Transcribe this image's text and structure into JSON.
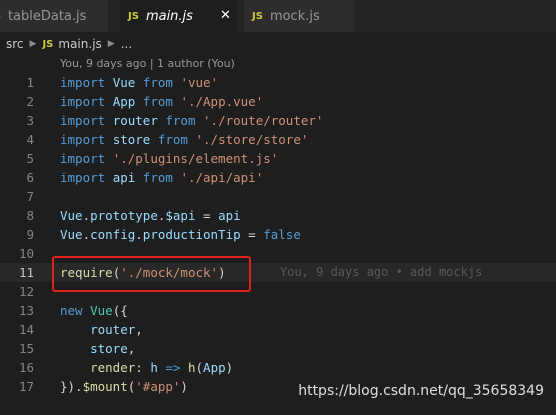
{
  "tabs": [
    {
      "icon": "JS",
      "label": "tableData.js"
    },
    {
      "icon": "JS",
      "label": "main.js",
      "close": "✕"
    },
    {
      "icon": "JS",
      "label": "mock.js"
    }
  ],
  "breadcrumb": {
    "folder": "src",
    "file_icon": "JS",
    "file": "main.js",
    "more": "..."
  },
  "codelens": "You, 9 days ago | 1 author (You)",
  "lines": [
    {
      "n": "1",
      "tokens": [
        [
          "kw",
          "import"
        ],
        [
          "pl",
          " "
        ],
        [
          "id",
          "Vue"
        ],
        [
          "pl",
          " "
        ],
        [
          "kw",
          "from"
        ],
        [
          "pl",
          " "
        ],
        [
          "str",
          "'vue'"
        ]
      ]
    },
    {
      "n": "2",
      "tokens": [
        [
          "kw",
          "import"
        ],
        [
          "pl",
          " "
        ],
        [
          "id",
          "App"
        ],
        [
          "pl",
          " "
        ],
        [
          "kw",
          "from"
        ],
        [
          "pl",
          " "
        ],
        [
          "str",
          "'./App.vue'"
        ]
      ]
    },
    {
      "n": "3",
      "tokens": [
        [
          "kw",
          "import"
        ],
        [
          "pl",
          " "
        ],
        [
          "id",
          "router"
        ],
        [
          "pl",
          " "
        ],
        [
          "kw",
          "from"
        ],
        [
          "pl",
          " "
        ],
        [
          "str",
          "'./route/router'"
        ]
      ]
    },
    {
      "n": "4",
      "tokens": [
        [
          "kw",
          "import"
        ],
        [
          "pl",
          " "
        ],
        [
          "id",
          "store"
        ],
        [
          "pl",
          " "
        ],
        [
          "kw",
          "from"
        ],
        [
          "pl",
          " "
        ],
        [
          "str",
          "'./store/store'"
        ]
      ]
    },
    {
      "n": "5",
      "tokens": [
        [
          "kw",
          "import"
        ],
        [
          "pl",
          " "
        ],
        [
          "str",
          "'./plugins/element.js'"
        ]
      ]
    },
    {
      "n": "6",
      "tokens": [
        [
          "kw",
          "import"
        ],
        [
          "pl",
          " "
        ],
        [
          "id",
          "api"
        ],
        [
          "pl",
          " "
        ],
        [
          "kw",
          "from"
        ],
        [
          "pl",
          " "
        ],
        [
          "str",
          "'./api/api'"
        ]
      ]
    },
    {
      "n": "7",
      "tokens": []
    },
    {
      "n": "8",
      "tokens": [
        [
          "id",
          "Vue"
        ],
        [
          "pl",
          "."
        ],
        [
          "id",
          "prototype"
        ],
        [
          "pl",
          "."
        ],
        [
          "id",
          "$api"
        ],
        [
          "pl",
          " = "
        ],
        [
          "id",
          "api"
        ]
      ]
    },
    {
      "n": "9",
      "tokens": [
        [
          "id",
          "Vue"
        ],
        [
          "pl",
          "."
        ],
        [
          "id",
          "config"
        ],
        [
          "pl",
          "."
        ],
        [
          "id",
          "productionTip"
        ],
        [
          "pl",
          " = "
        ],
        [
          "kw",
          "false"
        ]
      ]
    },
    {
      "n": "10",
      "tokens": []
    },
    {
      "n": "11",
      "tokens": [
        [
          "fn",
          "require"
        ],
        [
          "pl",
          "("
        ],
        [
          "str",
          "'./mock/mock'"
        ],
        [
          "pl",
          ")"
        ]
      ],
      "blame": "You, 9 days ago • add mockjs",
      "current": true
    },
    {
      "n": "12",
      "tokens": []
    },
    {
      "n": "13",
      "tokens": [
        [
          "kw",
          "new"
        ],
        [
          "pl",
          " "
        ],
        [
          "ty",
          "Vue"
        ],
        [
          "pl",
          "({"
        ]
      ]
    },
    {
      "n": "14",
      "tokens": [
        [
          "pl",
          "    "
        ],
        [
          "id",
          "router"
        ],
        [
          "pl",
          ","
        ]
      ]
    },
    {
      "n": "15",
      "tokens": [
        [
          "pl",
          "    "
        ],
        [
          "id",
          "store"
        ],
        [
          "pl",
          ","
        ]
      ]
    },
    {
      "n": "16",
      "tokens": [
        [
          "pl",
          "    "
        ],
        [
          "fn",
          "render"
        ],
        [
          "pl",
          ": "
        ],
        [
          "id",
          "h"
        ],
        [
          "pl",
          " "
        ],
        [
          "kw",
          "=>"
        ],
        [
          "pl",
          " "
        ],
        [
          "fn",
          "h"
        ],
        [
          "pl",
          "("
        ],
        [
          "id",
          "App"
        ],
        [
          "pl",
          ")"
        ]
      ]
    },
    {
      "n": "17",
      "tokens": [
        [
          "pl",
          "})."
        ],
        [
          "fn",
          "$mount"
        ],
        [
          "pl",
          "("
        ],
        [
          "str",
          "'#app'"
        ],
        [
          "pl",
          ")"
        ]
      ]
    }
  ],
  "watermark": "https://blog.csdn.net/qq_35658349"
}
